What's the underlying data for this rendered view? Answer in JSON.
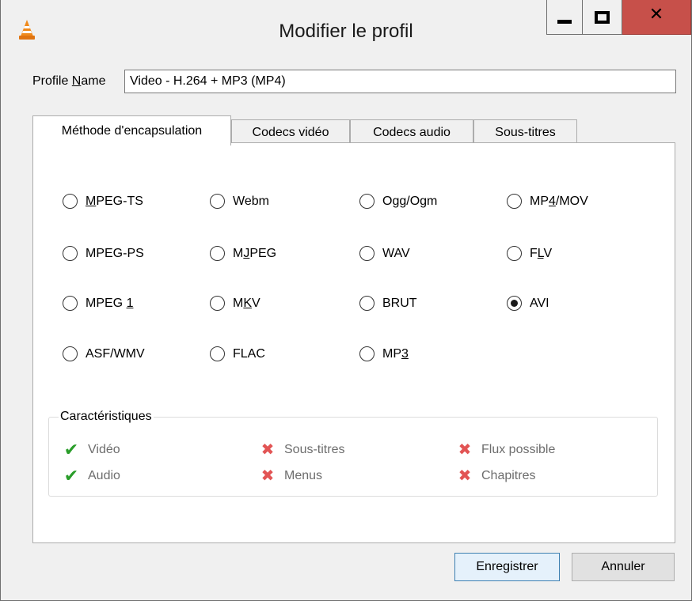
{
  "window": {
    "title": "Modifier le profil",
    "controls": {
      "minimize": "minimize-icon",
      "maximize": "maximize-icon",
      "close": "close-icon"
    }
  },
  "profile": {
    "label_pre": "Profile ",
    "label_ul": "N",
    "label_post": "ame",
    "value": "Video - H.264 + MP3 (MP4)"
  },
  "tabs": [
    {
      "label": "Méthode d'encapsulation",
      "active": true
    },
    {
      "label": "Codecs vidéo",
      "active": false
    },
    {
      "label": "Codecs audio",
      "active": false
    },
    {
      "label": "Sous-titres",
      "active": false
    }
  ],
  "containers": {
    "mpeg_ts": {
      "pre": "",
      "ul": "M",
      "post": "PEG-TS",
      "checked": false
    },
    "webm": {
      "pre": "Webm",
      "ul": "",
      "post": "",
      "checked": false
    },
    "ogg": {
      "pre": "Ogg/Ogm",
      "ul": "",
      "post": "",
      "checked": false
    },
    "mp4": {
      "pre": "MP",
      "ul": "4",
      "post": "/MOV",
      "checked": false
    },
    "mpeg_ps": {
      "pre": "MPEG-PS",
      "ul": "",
      "post": "",
      "checked": false
    },
    "mjpeg": {
      "pre": "M",
      "ul": "J",
      "post": "PEG",
      "checked": false
    },
    "wav": {
      "pre": "WAV",
      "ul": "",
      "post": "",
      "checked": false
    },
    "flv": {
      "pre": "F",
      "ul": "L",
      "post": "V",
      "checked": false
    },
    "mpeg1": {
      "pre": "MPEG ",
      "ul": "1",
      "post": "",
      "checked": false
    },
    "mkv": {
      "pre": "M",
      "ul": "K",
      "post": "V",
      "checked": false
    },
    "brut": {
      "pre": "BRUT",
      "ul": "",
      "post": "",
      "checked": false
    },
    "avi": {
      "pre": "AVI",
      "ul": "",
      "post": "",
      "checked": true
    },
    "asf": {
      "pre": "ASF/WMV",
      "ul": "",
      "post": "",
      "checked": false
    },
    "flac": {
      "pre": "FLAC",
      "ul": "",
      "post": "",
      "checked": false
    },
    "mp3": {
      "pre": "MP",
      "ul": "3",
      "post": "",
      "checked": false
    }
  },
  "features": {
    "title": "Caractéristiques",
    "video": {
      "label": "Vidéo",
      "icon": "check-icon",
      "color": "#2a9d2a"
    },
    "audio": {
      "label": "Audio",
      "icon": "check-icon",
      "color": "#2a9d2a"
    },
    "subtitles": {
      "label": "Sous-titres",
      "icon": "cross-icon",
      "color": "#e25454"
    },
    "menus": {
      "label": "Menus",
      "icon": "cross-icon",
      "color": "#e25454"
    },
    "streaming": {
      "label": "Flux possible",
      "icon": "cross-icon",
      "color": "#e25454"
    },
    "chapters": {
      "label": "Chapitres",
      "icon": "cross-icon",
      "color": "#e25454"
    }
  },
  "buttons": {
    "save": "Enregistrer",
    "cancel": "Annuler"
  }
}
